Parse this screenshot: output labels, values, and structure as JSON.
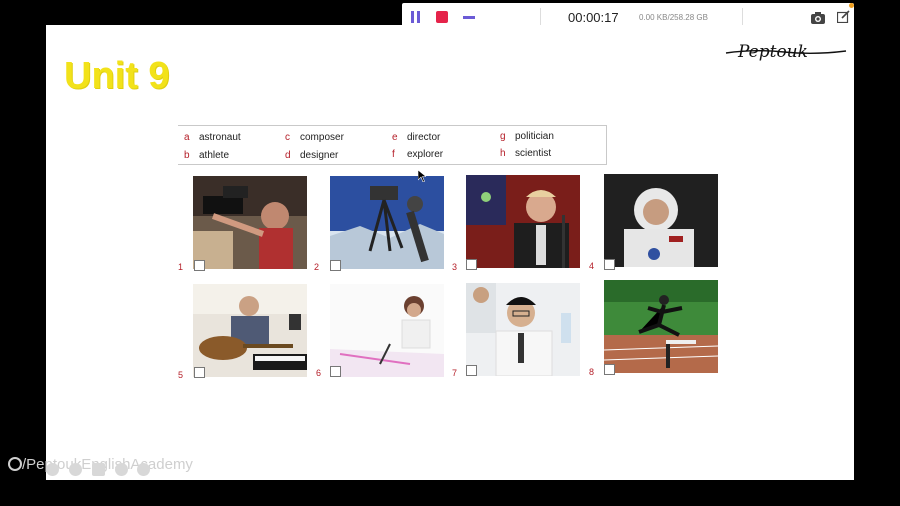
{
  "toolbar": {
    "timer": "00:00:17",
    "storage": "0.00 KB/258.28 GB",
    "icons": [
      "pause-icon",
      "stop-icon",
      "minimize-icon",
      "camera-icon",
      "edit-icon"
    ]
  },
  "slide": {
    "title": "Unit 9",
    "logo_text": "Peptouk",
    "words": [
      {
        "letter": "a",
        "word": "astronaut"
      },
      {
        "letter": "b",
        "word": "athlete"
      },
      {
        "letter": "c",
        "word": "composer"
      },
      {
        "letter": "d",
        "word": "designer"
      },
      {
        "letter": "e",
        "word": "director"
      },
      {
        "letter": "f",
        "word": "explorer"
      },
      {
        "letter": "g",
        "word": "politician"
      },
      {
        "letter": "h",
        "word": "scientist"
      }
    ],
    "pictures": [
      {
        "number": "1",
        "subject": "director-photo"
      },
      {
        "number": "2",
        "subject": "explorer-photo"
      },
      {
        "number": "3",
        "subject": "politician-photo"
      },
      {
        "number": "4",
        "subject": "astronaut-photo"
      },
      {
        "number": "5",
        "subject": "composer-photo"
      },
      {
        "number": "6",
        "subject": "designer-photo"
      },
      {
        "number": "7",
        "subject": "scientist-photo"
      },
      {
        "number": "8",
        "subject": "athlete-photo"
      }
    ]
  },
  "watermark": {
    "text": "/PeptoukEnglishAcademy"
  }
}
